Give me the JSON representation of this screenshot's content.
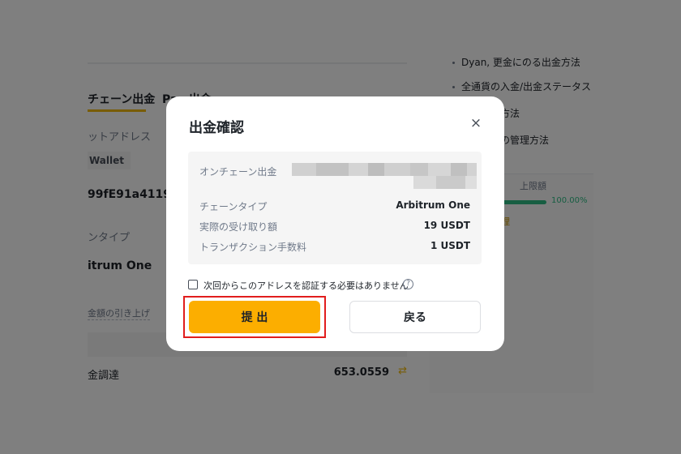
{
  "background": {
    "tabs": [
      "チェーン出金",
      "Pay 出金"
    ],
    "address_label": "ットアドレス",
    "wallet_chip": "Wallet",
    "address_value": "99fE91a4119B",
    "network_label": "ンタイプ",
    "network_value": "itrum One",
    "limit_link": "金額の引き上げ",
    "fund_label": "金調達",
    "fund_value": "653.0559",
    "faq": [
      "Dyan, 更金にのる出金方法",
      "全通貨の入金/出金ステータス",
      "額の変更方法",
      "ドレス帳の管理方法"
    ],
    "limit_card_title": "上限額",
    "limit_percent": "100.00%",
    "limit_progress_fraction": 1.0,
    "limit_card_link": "理"
  },
  "modal": {
    "title": "出金確認",
    "rows": [
      {
        "label": "オンチェーン出金",
        "value": ""
      },
      {
        "label": "チェーンタイプ",
        "value": "Arbitrum One"
      },
      {
        "label": "実際の受け取り額",
        "value": "19 USDT"
      },
      {
        "label": "トランザクション手数料",
        "value": "1 USDT"
      }
    ],
    "checkbox_label": "次回からこのアドレスを認証する必要はありません",
    "help_symbol": "?",
    "close_symbol": "×",
    "submit_label": "提 出",
    "back_label": "戻る"
  },
  "colors": {
    "accent": "#fcae00",
    "highlight": "#e11d1d",
    "success": "#2ebd85"
  }
}
